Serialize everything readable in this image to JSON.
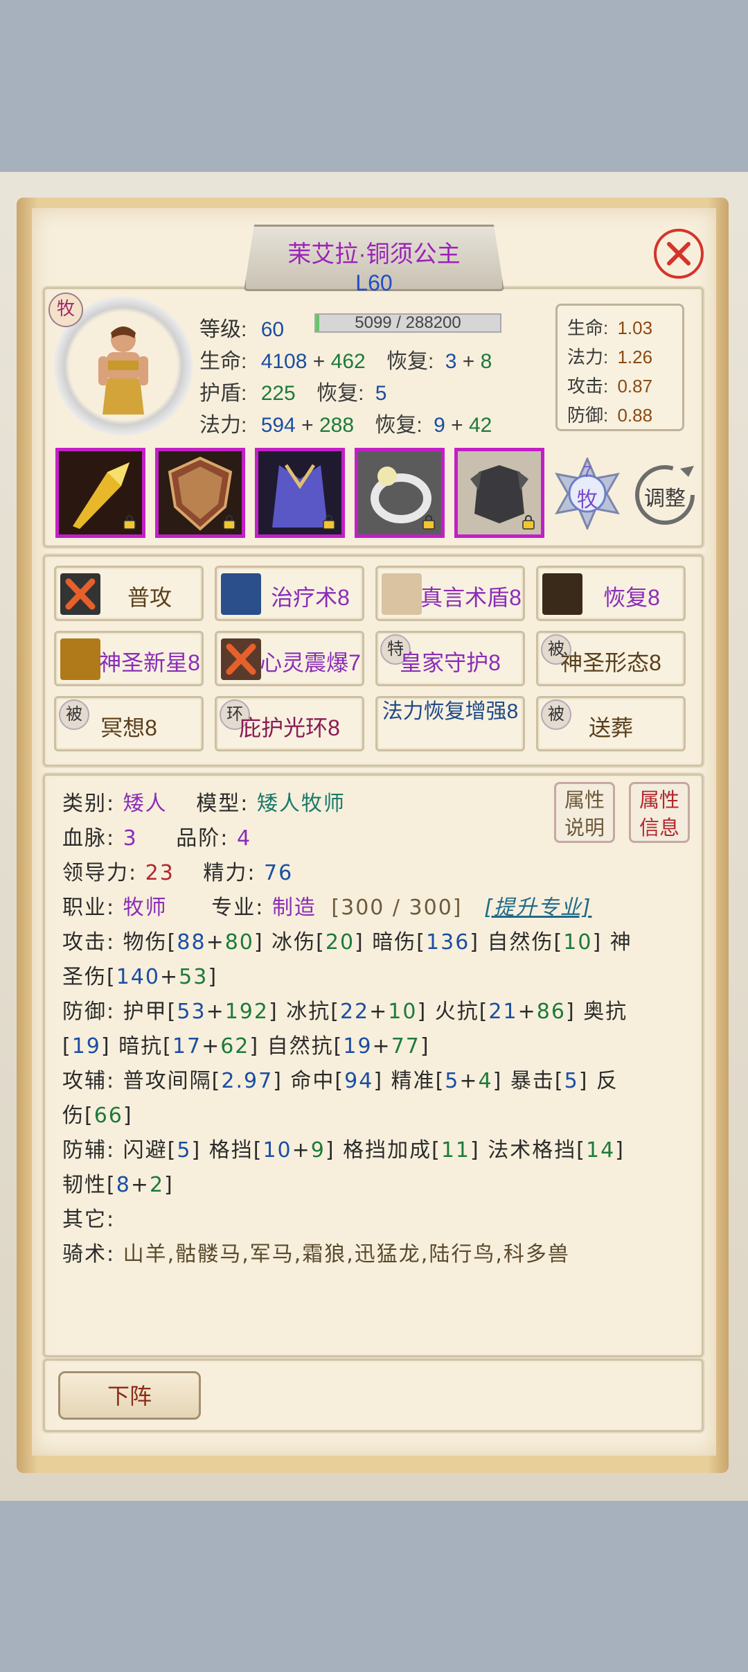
{
  "hero": {
    "name": "茉艾拉·铜须公主",
    "level_label": "L60",
    "class_badge": "牧"
  },
  "stats": {
    "level_label": "等级:",
    "level": "60",
    "exp_text": "5099 / 288200",
    "exp_fraction": 0.0177,
    "hp_label": "生命:",
    "hp_base": "4108",
    "hp_bonus": "462",
    "hp_regen_label": "恢复:",
    "hp_regen_base": "3",
    "hp_regen_bonus": "8",
    "shield_label": "护盾:",
    "shield": "225",
    "shield_regen_label": "恢复:",
    "shield_regen": "5",
    "mana_label": "法力:",
    "mana_base": "594",
    "mana_bonus": "288",
    "mana_regen_label": "恢复:",
    "mana_regen_base": "9",
    "mana_regen_bonus": "42",
    "plus": "+"
  },
  "multipliers": [
    {
      "label": "生命:",
      "value": "1.03"
    },
    {
      "label": "法力:",
      "value": "1.26"
    },
    {
      "label": "攻击:",
      "value": "0.87"
    },
    {
      "label": "防御:",
      "value": "0.88"
    }
  ],
  "equipment": [
    {
      "name": "golden-spear-icon"
    },
    {
      "name": "bronze-shield-icon"
    },
    {
      "name": "blue-robe-icon"
    },
    {
      "name": "silver-ring-icon"
    },
    {
      "name": "dark-armor-icon"
    }
  ],
  "class_emblem": {
    "number": "7",
    "label": "牧"
  },
  "adjust_label": "调整",
  "skills": [
    {
      "label": "普攻",
      "tag": "",
      "icon": "cancel-attack-icon",
      "color": "#5a3f1c"
    },
    {
      "label": "治疗术8",
      "tag": "",
      "icon": "heal-icon",
      "color": "#8b2db7"
    },
    {
      "label": "真言术盾8",
      "tag": "",
      "icon": "word-shield-icon",
      "color": "#8b2db7"
    },
    {
      "label": "恢复8",
      "tag": "",
      "icon": "renew-icon",
      "color": "#8b2db7"
    },
    {
      "label": "神圣新星8",
      "tag": "",
      "icon": "holy-nova-icon",
      "color": "#8b2db7"
    },
    {
      "label": "心灵震爆7",
      "tag": "",
      "icon": "mind-blast-icon",
      "color": "#8b2db7"
    },
    {
      "label": "皇家守护8",
      "tag": "特",
      "icon": "",
      "color": "#8b2db7"
    },
    {
      "label": "神圣形态8",
      "tag": "被",
      "icon": "",
      "color": "#5a3f1c"
    },
    {
      "label": "冥想8",
      "tag": "被",
      "icon": "",
      "color": "#5a3f1c"
    },
    {
      "label": "庇护光环8",
      "tag": "环",
      "icon": "",
      "color": "#8a1a52"
    },
    {
      "label": "法力恢复增强8",
      "tag": "",
      "icon": "",
      "color": "#1f4a86"
    },
    {
      "label": "送葬",
      "tag": "被",
      "icon": "",
      "color": "#5a3f1c"
    }
  ],
  "info": {
    "race_label": "类别:",
    "race": "矮人",
    "model_label": "模型:",
    "model": "矮人牧师",
    "bloodline_label": "血脉:",
    "bloodline": "3",
    "grade_label": "品阶:",
    "grade": "4",
    "leadership_label": "领导力:",
    "leadership": "23",
    "energy_label": "精力:",
    "energy": "76",
    "job_label": "职业:",
    "job": "牧师",
    "profession_label": "专业:",
    "profession": "制造",
    "profession_progress": "[300 / 300]",
    "upgrade_link": "[提升专业]",
    "attr_explain_button": [
      "属性",
      "说明"
    ],
    "attr_info_button": [
      "属性",
      "信息"
    ]
  },
  "attack": {
    "label": "攻击:",
    "physical": "物伤",
    "physical_base": "88",
    "physical_bonus": "80",
    "ice": "冰伤",
    "ice_val": "20",
    "shadow": "暗伤",
    "shadow_val": "136",
    "nature": "自然伤",
    "nature_val": "10",
    "holy": "神圣伤",
    "holy_base": "140",
    "holy_bonus": "53"
  },
  "defense": {
    "label": "防御:",
    "armor": "护甲",
    "armor_base": "53",
    "armor_bonus": "192",
    "ice_res": "冰抗",
    "ice_base": "22",
    "ice_bonus": "10",
    "fire_res": "火抗",
    "fire_base": "21",
    "fire_bonus": "86",
    "arcane_res": "奥抗",
    "arcane_val": "19",
    "shadow_res": "暗抗",
    "shadow_base": "17",
    "shadow_bonus": "62",
    "nature_res": "自然抗",
    "nature_base": "19",
    "nature_bonus": "77"
  },
  "attack_aux": {
    "label": "攻辅:",
    "interval": "普攻间隔",
    "interval_val": "2.97",
    "hit": "命中",
    "hit_val": "94",
    "precision": "精准",
    "precision_base": "5",
    "precision_bonus": "4",
    "crit": "暴击",
    "crit_val": "5",
    "reflect": "反伤",
    "reflect_val": "66"
  },
  "defense_aux": {
    "label": "防辅:",
    "dodge": "闪避",
    "dodge_val": "5",
    "block": "格挡",
    "block_base": "10",
    "block_bonus": "9",
    "block_bonus_label": "格挡加成",
    "block_bonus_val": "11",
    "spell_block": "法术格挡",
    "spell_block_val": "14",
    "toughness": "韧性",
    "toughness_base": "8",
    "toughness_bonus": "2"
  },
  "other_label": "其它:",
  "riding": {
    "label": "骑术:",
    "mounts": "山羊,骷髅马,军马,霜狼,迅猛龙,陆行鸟,科多兽"
  },
  "bottom": {
    "dismiss_button": "下阵"
  },
  "colors": {
    "panel": "#f7efdc",
    "name_purple": "#9b22b8",
    "level_blue": "#1f4fc9",
    "value_blue": "#1a4ea3",
    "bonus_green": "#1d7a3a",
    "equip_border": "#c31fc7",
    "close_red": "#d4342b"
  }
}
